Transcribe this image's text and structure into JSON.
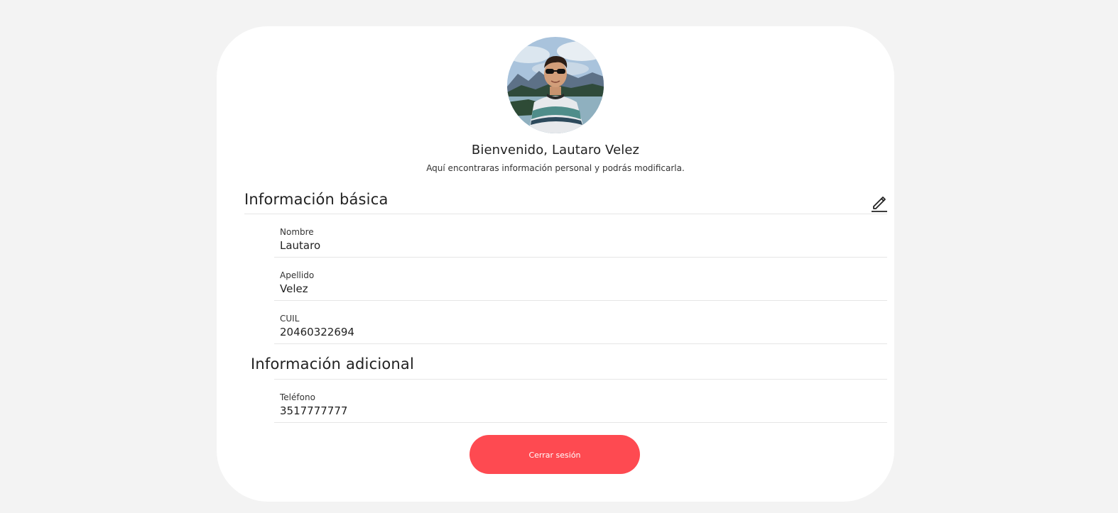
{
  "profile": {
    "welcome": "Bienvenido, Lautaro Velez",
    "subtitle": "Aquí encontraras información personal y podrás modificarla."
  },
  "sections": {
    "basic": {
      "title": "Información básica",
      "fields": [
        {
          "label": "Nombre",
          "value": "Lautaro"
        },
        {
          "label": "Apellido",
          "value": "Velez"
        },
        {
          "label": "CUIL",
          "value": "20460322694"
        }
      ]
    },
    "additional": {
      "title": "Información adicional",
      "fields": [
        {
          "label": "Teléfono",
          "value": "3517777777"
        }
      ]
    }
  },
  "actions": {
    "logout_label": "Cerrar sesión"
  },
  "icons": {
    "edit": "pencil-icon"
  },
  "colors": {
    "background": "#f3f3f3",
    "card": "#ffffff",
    "accent": "#fe4a51",
    "divider": "#e6e6e6"
  }
}
